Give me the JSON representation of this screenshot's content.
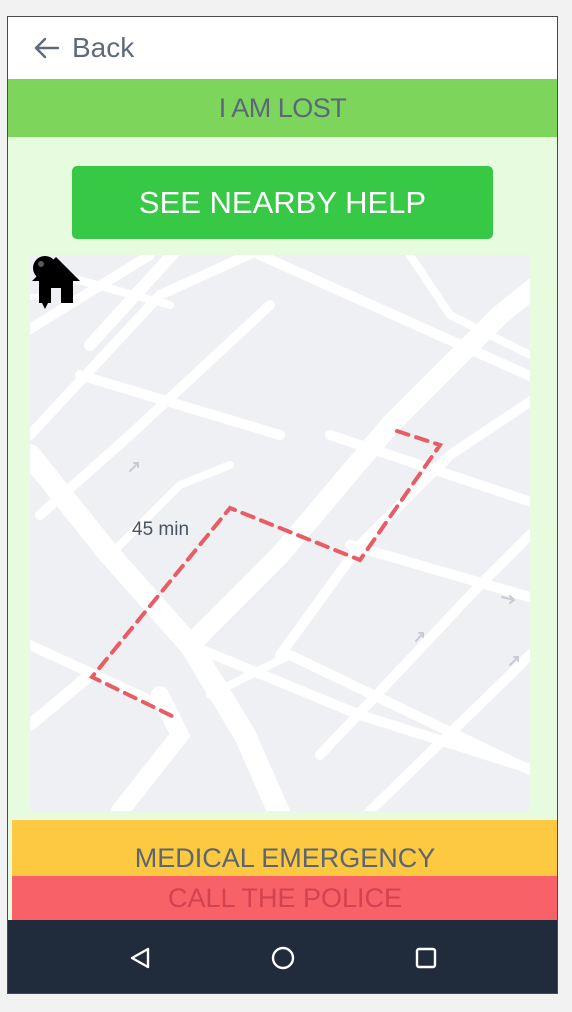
{
  "header": {
    "back_label": "Back"
  },
  "screen": {
    "title": "I AM LOST"
  },
  "actions": {
    "nearby_help_label": "SEE NEARBY HELP",
    "medical_label": "MEDICAL EMERGENCY",
    "police_label": "CALL THE POLICE"
  },
  "map": {
    "eta_label": "45 min",
    "route_color": "#e85d64",
    "road_color": "#ffffff",
    "background_color": "#eef0f4"
  },
  "icons": {
    "back": "arrow-left-icon",
    "home": "home-icon",
    "location": "location-pin-icon",
    "nav_back": "triangle-back-icon",
    "nav_home": "circle-home-icon",
    "nav_recents": "square-recents-icon"
  },
  "colors": {
    "title_bar": "#7ed55c",
    "help_button": "#37c946",
    "medical": "#fcc940",
    "police": "#f86168",
    "navbar": "#202b3b"
  }
}
